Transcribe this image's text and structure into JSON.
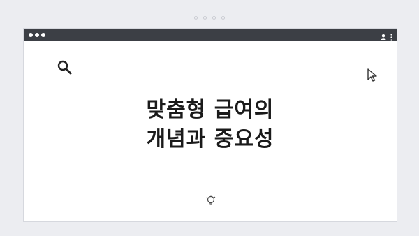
{
  "pager": {
    "dots": 4
  },
  "window": {
    "titlebar": {
      "controls": [
        "close",
        "minimize",
        "maximize"
      ],
      "right_icons": [
        "user-icon",
        "more-vertical-icon"
      ]
    }
  },
  "slide": {
    "title_line1": "맞춤형 급여의",
    "title_line2": "개념과 중요성",
    "icons": [
      "search-icon",
      "cursor-icon",
      "lightbulb-icon"
    ]
  },
  "colors": {
    "background": "#ecedf1",
    "titlebar": "#3c3f45",
    "text": "#1a1a1a"
  }
}
